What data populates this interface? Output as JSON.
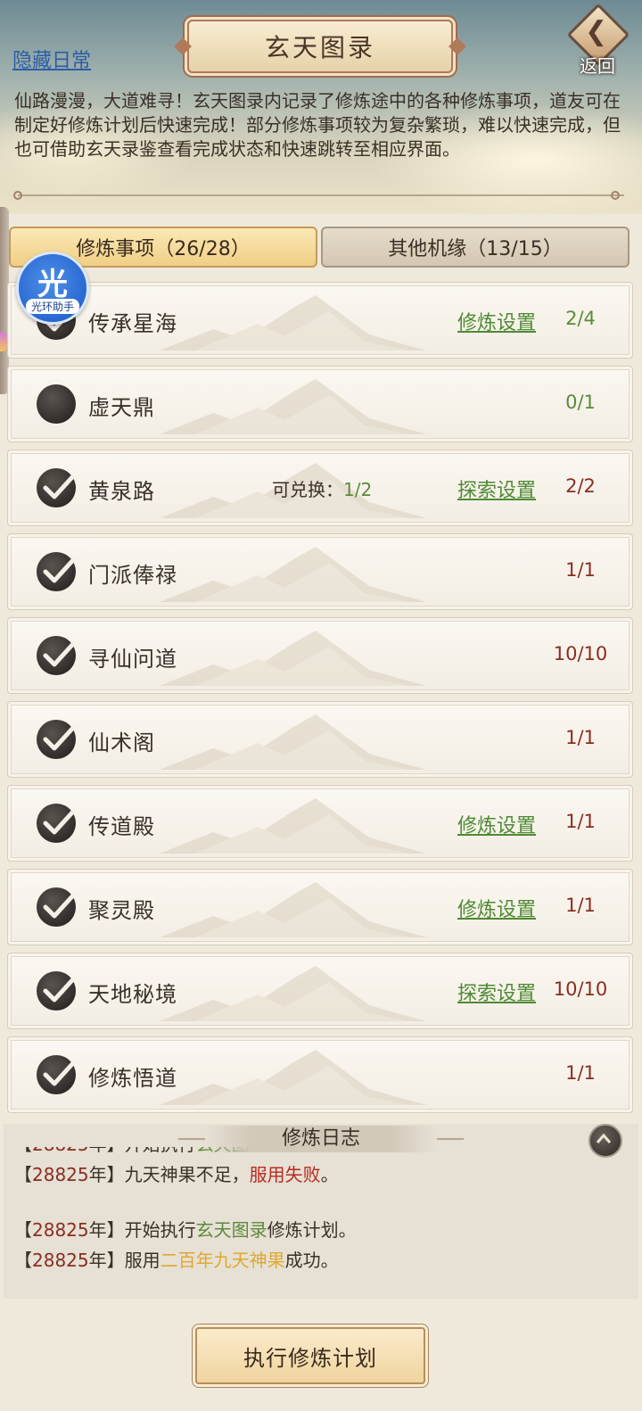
{
  "header": {
    "title": "玄天图录",
    "hidden_daily_link": "隐藏日常",
    "back_label": "返回",
    "intro": "仙路漫漫，大道难寻！玄天图录内记录了修炼途中的各种修炼事项，道友可在制定好修炼计划后快速完成！部分修炼事项较为复杂繁琐，难以快速完成，但也可借助玄天录鉴查看完成状态和快速跳转至相应界面。"
  },
  "tabs": [
    {
      "label": "修炼事项（26/28）",
      "active": true
    },
    {
      "label": "其他机缘（13/15）",
      "active": false
    }
  ],
  "assistant": {
    "char": "光",
    "label": "光环助手"
  },
  "items": [
    {
      "name": "传承星海",
      "done": true,
      "link": "修炼设置",
      "count": "2/4",
      "count_color": "green"
    },
    {
      "name": "虚天鼎",
      "done": false,
      "link": "",
      "count": "0/1",
      "count_color": "green"
    },
    {
      "name": "黄泉路",
      "done": true,
      "exchange_label": "可兑换：",
      "exchange_value": "1/2",
      "link": "探索设置",
      "count": "2/2",
      "count_color": "red"
    },
    {
      "name": "门派俸禄",
      "done": true,
      "link": "",
      "count": "1/1",
      "count_color": "red"
    },
    {
      "name": "寻仙问道",
      "done": true,
      "link": "",
      "count": "10/10",
      "count_color": "red"
    },
    {
      "name": "仙术阁",
      "done": true,
      "link": "",
      "count": "1/1",
      "count_color": "red"
    },
    {
      "name": "传道殿",
      "done": true,
      "link": "修炼设置",
      "count": "1/1",
      "count_color": "red"
    },
    {
      "name": "聚灵殿",
      "done": true,
      "link": "修炼设置",
      "count": "1/1",
      "count_color": "red"
    },
    {
      "name": "天地秘境",
      "done": true,
      "link": "探索设置",
      "count": "10/10",
      "count_color": "red"
    },
    {
      "name": "修炼悟道",
      "done": true,
      "link": "",
      "count": "1/1",
      "count_color": "red"
    }
  ],
  "log": {
    "title": "修炼日志",
    "lines": [
      [
        {
          "t": "【"
        },
        {
          "t": "28825",
          "c": "yr"
        },
        {
          "t": "年】开始执行"
        },
        {
          "t": "玄天图录",
          "c": "green"
        },
        {
          "t": "修炼计划。"
        }
      ],
      [
        {
          "t": "【"
        },
        {
          "t": "28825",
          "c": "yr"
        },
        {
          "t": "年】九天神果不足，"
        },
        {
          "t": "服用失败",
          "c": "red"
        },
        {
          "t": "。"
        }
      ],
      [],
      [
        {
          "t": "【"
        },
        {
          "t": "28825",
          "c": "yr"
        },
        {
          "t": "年】开始执行"
        },
        {
          "t": "玄天图录",
          "c": "green"
        },
        {
          "t": "修炼计划。"
        }
      ],
      [
        {
          "t": "【"
        },
        {
          "t": "28825",
          "c": "yr"
        },
        {
          "t": "年】服用"
        },
        {
          "t": "二百年九天神果",
          "c": "gold"
        },
        {
          "t": "成功。"
        }
      ]
    ]
  },
  "execute_button": "执行修炼计划",
  "colors": {
    "link_green": "#4e8a33",
    "count_red": "#8a2d22",
    "count_green": "#5c8a3a",
    "tab_active": "#f0cf86"
  }
}
